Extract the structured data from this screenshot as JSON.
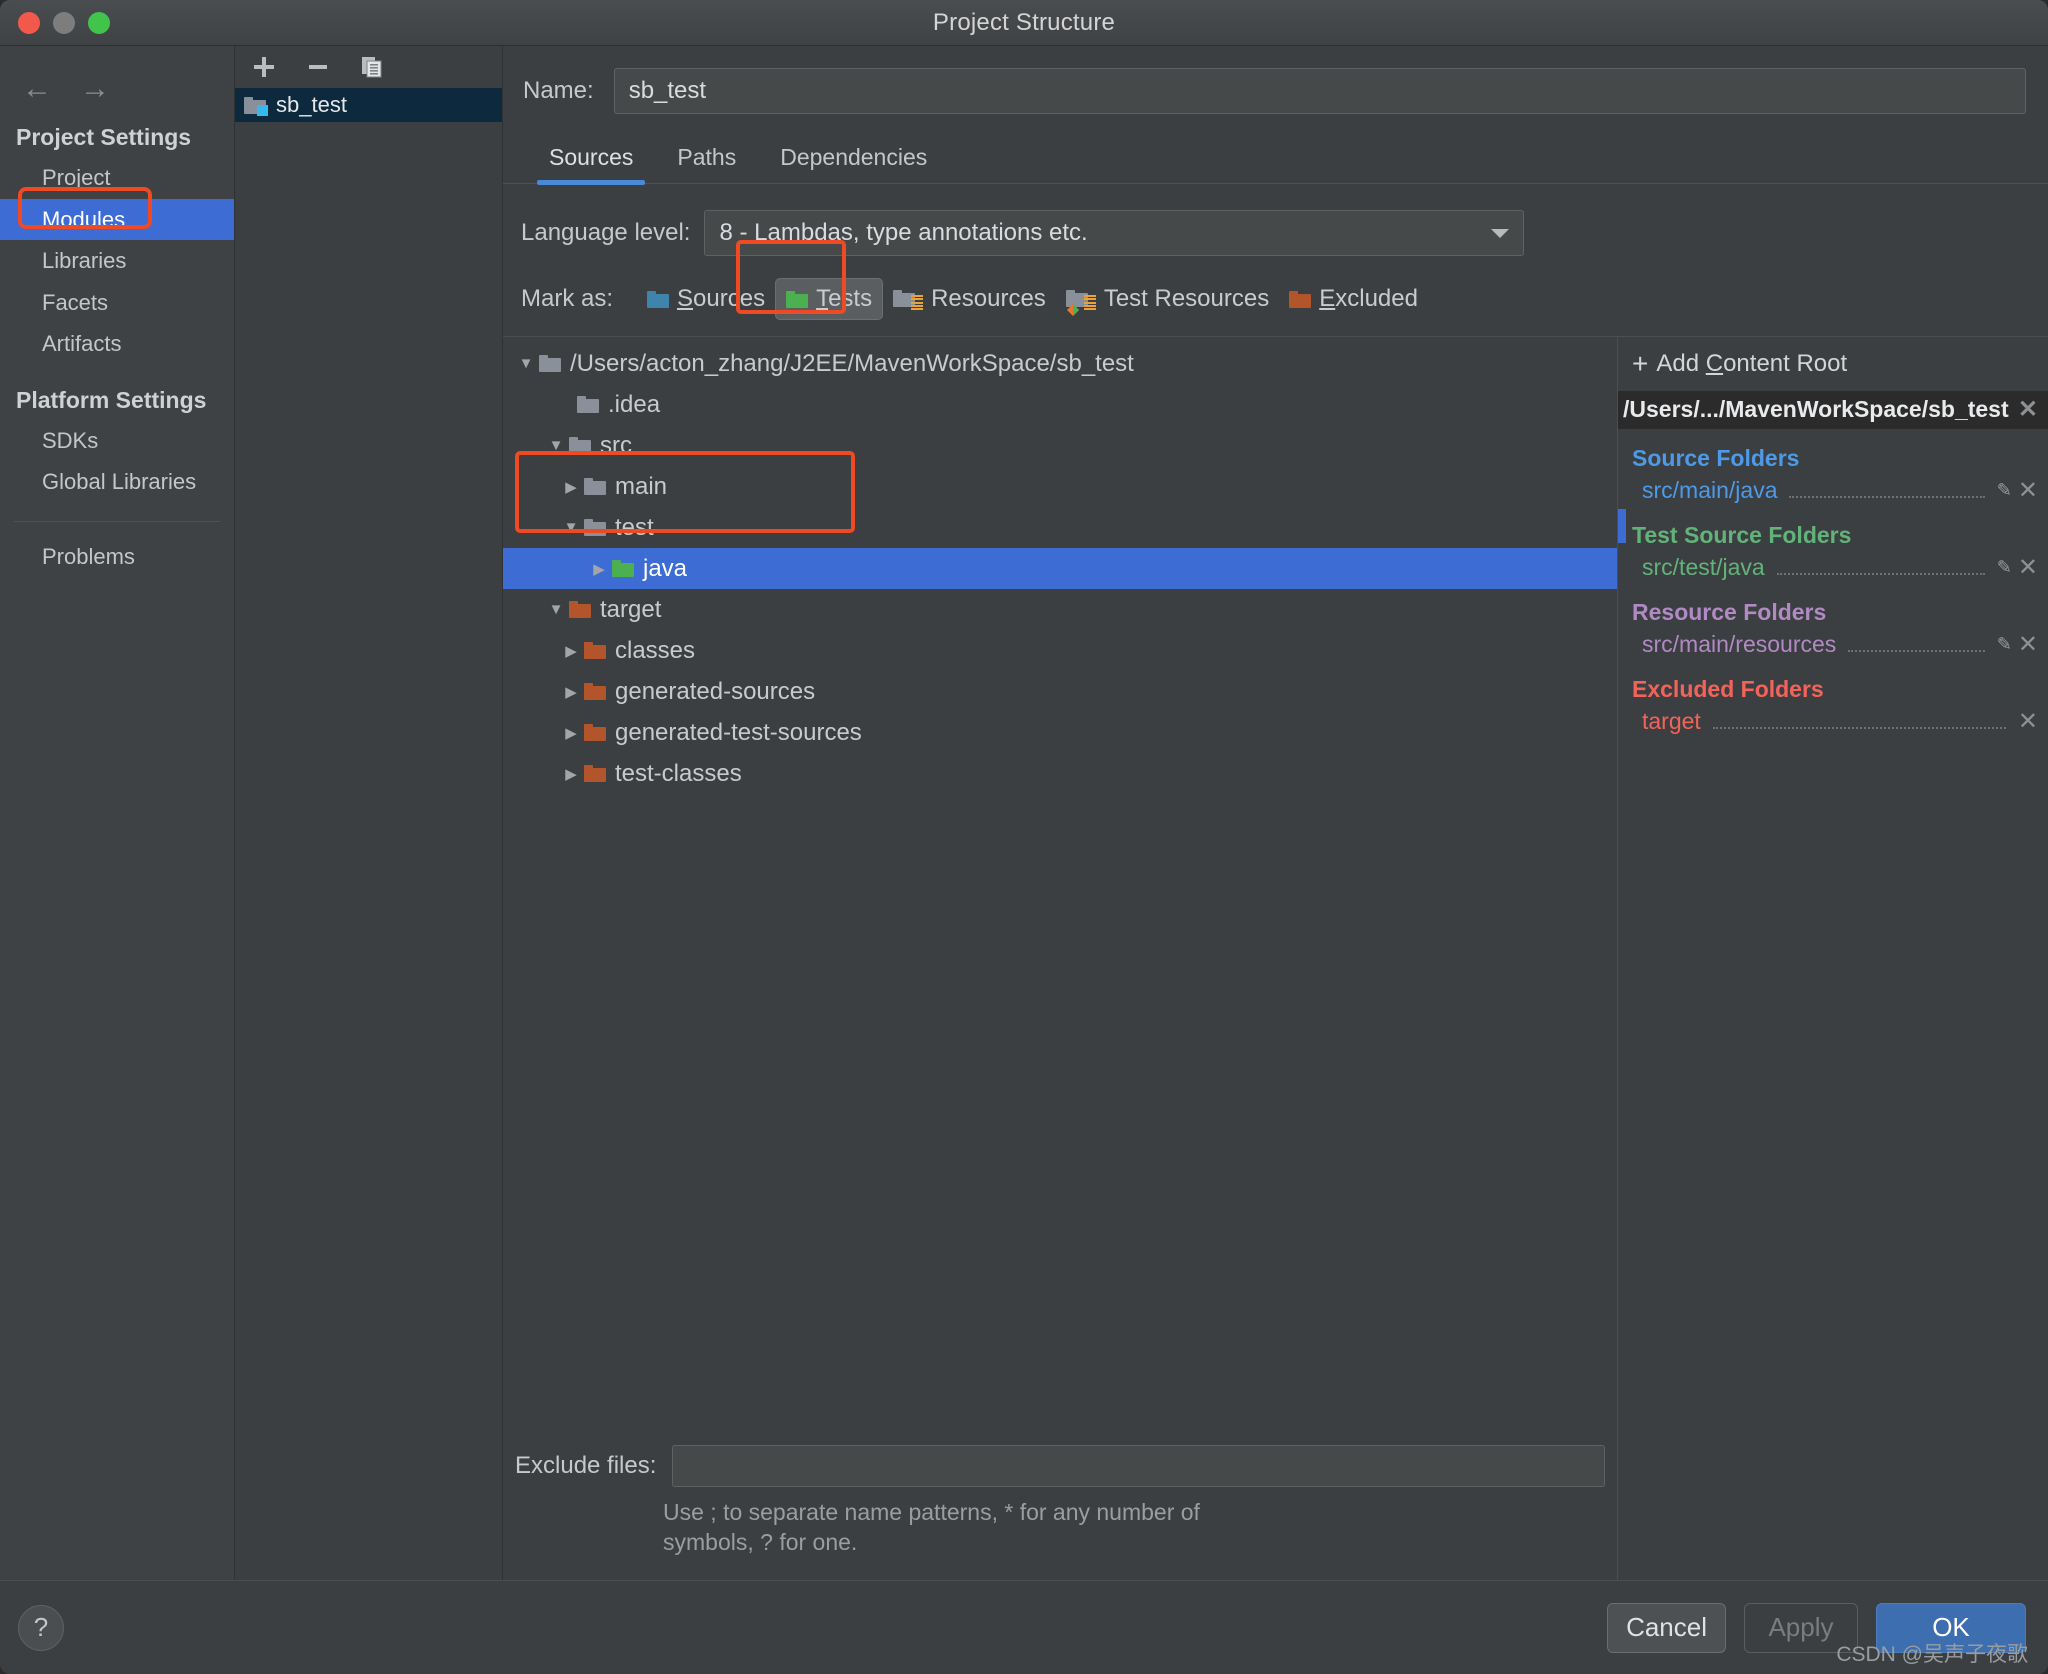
{
  "window": {
    "title": "Project Structure",
    "traffic_lights": [
      "close-red",
      "minimize-yellow",
      "zoom-green"
    ]
  },
  "sidebar": {
    "back_icon": "←",
    "forward_icon": "→",
    "sections": [
      {
        "header": "Project Settings",
        "items": [
          {
            "label": "Project",
            "selected": false
          },
          {
            "label": "Modules",
            "selected": true
          },
          {
            "label": "Libraries",
            "selected": false
          },
          {
            "label": "Facets",
            "selected": false
          },
          {
            "label": "Artifacts",
            "selected": false
          }
        ]
      },
      {
        "header": "Platform Settings",
        "items": [
          {
            "label": "SDKs",
            "selected": false
          },
          {
            "label": "Global Libraries",
            "selected": false
          }
        ]
      }
    ],
    "problems_label": "Problems"
  },
  "modules_panel": {
    "toolbar": {
      "add": "+",
      "remove": "−",
      "copy": "copy"
    },
    "modules": [
      {
        "label": "sb_test",
        "selected": true
      }
    ]
  },
  "main": {
    "name_label": "Name:",
    "name_value": "sb_test",
    "tabs": [
      {
        "label": "Sources",
        "active": true
      },
      {
        "label": "Paths",
        "active": false
      },
      {
        "label": "Dependencies",
        "active": false
      }
    ],
    "language_level_label": "Language level:",
    "language_level_value": "8 - Lambdas, type annotations etc.",
    "mark_as_label": "Mark as:",
    "mark_buttons": [
      {
        "label": "Sources",
        "mnemonic": "S",
        "rest": "ources",
        "icon": "folder-blue-icon",
        "selected": false
      },
      {
        "label": "Tests",
        "mnemonic": "T",
        "rest": "ests",
        "icon": "folder-green-icon",
        "selected": true
      },
      {
        "label": "Resources",
        "mnemonic": "",
        "rest": "Resources",
        "icon": "folder-resources-icon",
        "selected": false
      },
      {
        "label": "Test Resources",
        "mnemonic": "",
        "rest": "Test Resources",
        "icon": "folder-test-resources-icon",
        "selected": false
      },
      {
        "label": "Excluded",
        "mnemonic": "E",
        "rest": "xcluded",
        "icon": "folder-orange-icon",
        "selected": false
      }
    ],
    "tree": [
      {
        "label": "/Users/acton_zhang/J2EE/MavenWorkSpace/sb_test",
        "depth": 0,
        "twisty": "expanded",
        "folder": "gray",
        "selected": false
      },
      {
        "label": ".idea",
        "depth": 1,
        "twisty": "none",
        "folder": "gray",
        "selected": false
      },
      {
        "label": "src",
        "depth": 1,
        "twisty": "expanded",
        "folder": "gray",
        "selected": false
      },
      {
        "label": "main",
        "depth": 2,
        "twisty": "collapsed",
        "folder": "gray",
        "selected": false
      },
      {
        "label": "test",
        "depth": 2,
        "twisty": "expanded",
        "folder": "gray",
        "selected": false
      },
      {
        "label": "java",
        "depth": 3,
        "twisty": "collapsed",
        "folder": "green",
        "selected": true
      },
      {
        "label": "target",
        "depth": 1,
        "twisty": "expanded",
        "folder": "orange",
        "selected": false
      },
      {
        "label": "classes",
        "depth": 2,
        "twisty": "collapsed",
        "folder": "orange",
        "selected": false
      },
      {
        "label": "generated-sources",
        "depth": 2,
        "twisty": "collapsed",
        "folder": "orange",
        "selected": false
      },
      {
        "label": "generated-test-sources",
        "depth": 2,
        "twisty": "collapsed",
        "folder": "orange",
        "selected": false
      },
      {
        "label": "test-classes",
        "depth": 2,
        "twisty": "collapsed",
        "folder": "orange",
        "selected": false
      }
    ],
    "exclude_files_label": "Exclude files:",
    "exclude_files_value": "",
    "exclude_hint": "Use ; to separate name patterns, * for any number of symbols, ? for one."
  },
  "right_panel": {
    "add_content_root_plus": "+",
    "add_content_root_label_pre": "Add ",
    "add_content_root_mnemonic": "C",
    "add_content_root_label_post": "ontent Root",
    "content_root": "/Users/.../MavenWorkSpace/sb_test",
    "close_glyph": "✕",
    "groups": [
      {
        "title": "Source Folders",
        "color": "#4d9ae8",
        "entries": [
          {
            "path": "src/main/java",
            "has_pencil": true
          }
        ]
      },
      {
        "title": "Test Source Folders",
        "color": "#62b37a",
        "entries": [
          {
            "path": "src/test/java",
            "has_pencil": true
          }
        ]
      },
      {
        "title": "Resource Folders",
        "color": "#b18ac4",
        "entries": [
          {
            "path": "src/main/resources",
            "has_pencil": true
          }
        ]
      },
      {
        "title": "Excluded Folders",
        "color": "#f4635a",
        "entries": [
          {
            "path": "target",
            "has_pencil": false
          }
        ]
      }
    ]
  },
  "footer": {
    "help_glyph": "?",
    "cancel_label": "Cancel",
    "apply_label": "Apply",
    "ok_label": "OK",
    "watermark": "CSDN @吴声子夜歌"
  },
  "annotations": {
    "accent_color": "#f04a24",
    "boxes": [
      "modules-nav-item",
      "tests-mark-button",
      "test-java-tree-rows"
    ]
  }
}
